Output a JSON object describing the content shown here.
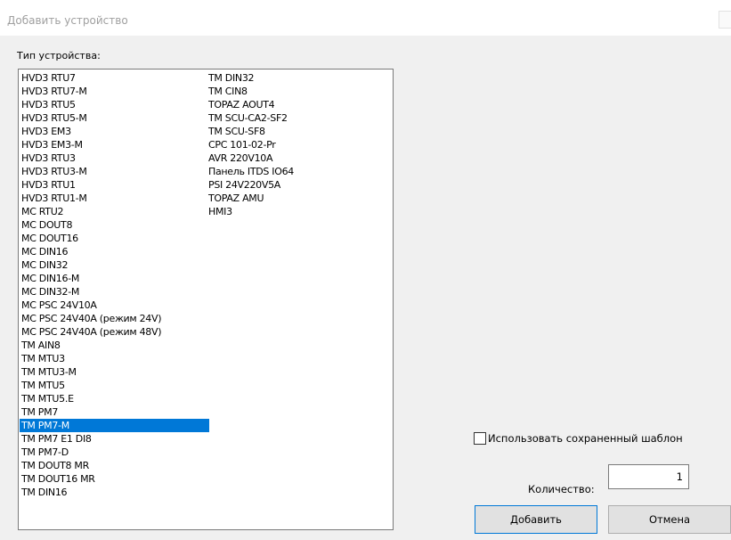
{
  "window": {
    "title": "Добавить устройство"
  },
  "device_type_label": "Тип устройства:",
  "device_list": {
    "column1": [
      "HVD3 RTU7",
      "HVD3 RTU7-M",
      "HVD3 RTU5",
      "HVD3 RTU5-M",
      "HVD3 EM3",
      "HVD3 EM3-M",
      "HVD3 RTU3",
      "HVD3 RTU3-M",
      "HVD3 RTU1",
      "HVD3 RTU1-M",
      "MC RTU2",
      "MC DOUT8",
      "MC DOUT16",
      "MC DIN16",
      "MC DIN32",
      "MC DIN16-M",
      "MC DIN32-M",
      "MC PSC 24V10A",
      "MC PSC 24V40A (режим 24V)",
      "MC PSC 24V40A (режим 48V)",
      "TM AIN8",
      "TM MTU3",
      "TM MTU3-M",
      "TM MTU5",
      "TM MTU5.E",
      "TM PM7",
      "TM PM7-M",
      "TM PM7 E1 DI8",
      "TM PM7-D",
      "TM DOUT8 MR",
      "TM DOUT16 MR",
      "TM DIN16"
    ],
    "column2": [
      "TM DIN32",
      "TM CIN8",
      "TOPAZ AOUT4",
      "TM SCU-CA2-SF2",
      "TM SCU-SF8",
      "CPC 101-02-Pr",
      "AVR 220V10A",
      "Панель ITDS IO64",
      "PSI 24V220V5A",
      "TOPAZ AMU",
      "HMI3"
    ],
    "selected": "TM PM7-M",
    "selection_color": "#0078d7"
  },
  "use_template": {
    "label": "Использовать сохраненный шаблон",
    "checked": false
  },
  "quantity": {
    "label": "Количество:",
    "value": "1"
  },
  "buttons": {
    "add": "Добавить",
    "cancel": "Отмена"
  }
}
